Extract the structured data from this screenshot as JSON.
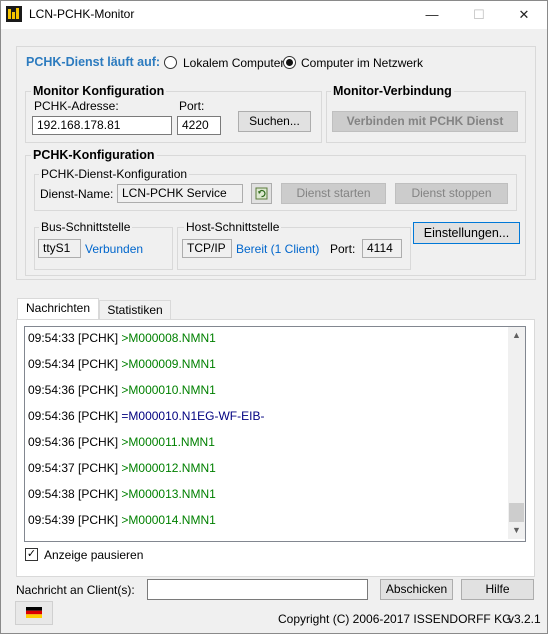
{
  "window": {
    "title": "LCN-PCHK-Monitor",
    "minimize": "—",
    "maximize": "☐",
    "close": "✕"
  },
  "service_location": {
    "label": "PCHK-Dienst läuft auf:",
    "option_local": "Lokalem Computer",
    "option_network": "Computer im Netzwerk",
    "selected": "network"
  },
  "monitor_config": {
    "title": "Monitor Konfiguration",
    "address_label": "PCHK-Adresse:",
    "address_value": "192.168.178.81",
    "port_label": "Port:",
    "port_value": "4220",
    "search_button": "Suchen..."
  },
  "monitor_connection": {
    "title": "Monitor-Verbindung",
    "connect_button": "Verbinden mit PCHK Dienst"
  },
  "pchk_config": {
    "title": "PCHK-Konfiguration",
    "service_group": "PCHK-Dienst-Konfiguration",
    "service_name_label": "Dienst-Name:",
    "service_name_value": "LCN-PCHK Service",
    "start_button": "Dienst starten",
    "stop_button": "Dienst stoppen",
    "bus_group": "Bus-Schnittstelle",
    "bus_value": "ttyS1",
    "bus_status": "Verbunden",
    "host_group": "Host-Schnittstelle",
    "host_value": "TCP/IP",
    "host_status": "Bereit (1 Client)",
    "host_port_label": "Port:",
    "host_port_value": "4114",
    "settings_button": "Einstellungen..."
  },
  "tabs": [
    {
      "label": "Nachrichten",
      "active": true
    },
    {
      "label": "Statistiken",
      "active": false
    }
  ],
  "log": [
    {
      "time": "09:54:33 [PCHK]",
      "msg": ">M000008.NMN1",
      "color": "#008000"
    },
    {
      "time": "09:54:34 [PCHK]",
      "msg": ">M000009.NMN1",
      "color": "#008000"
    },
    {
      "time": "09:54:36 [PCHK]",
      "msg": ">M000010.NMN1",
      "color": "#008000"
    },
    {
      "time": "09:54:36 [PCHK]",
      "msg": "=M000010.N1EG-WF-EIB-",
      "color": "#000080"
    },
    {
      "time": "09:54:36 [PCHK]",
      "msg": ">M000011.NMN1",
      "color": "#008000"
    },
    {
      "time": "09:54:37 [PCHK]",
      "msg": ">M000012.NMN1",
      "color": "#008000"
    },
    {
      "time": "09:54:38 [PCHK]",
      "msg": ">M000013.NMN1",
      "color": "#008000"
    },
    {
      "time": "09:54:39 [PCHK]",
      "msg": ">M000014.NMN1",
      "color": "#008000"
    }
  ],
  "pause": {
    "label": "Anzeige pausieren",
    "checked": true
  },
  "message": {
    "label": "Nachricht an Client(s):",
    "value": "",
    "send_button": "Abschicken",
    "help_button": "Hilfe"
  },
  "footer": {
    "copyright": "Copyright (C) 2006-2017 ISSENDORFF KG",
    "version": "v3.2.1"
  }
}
